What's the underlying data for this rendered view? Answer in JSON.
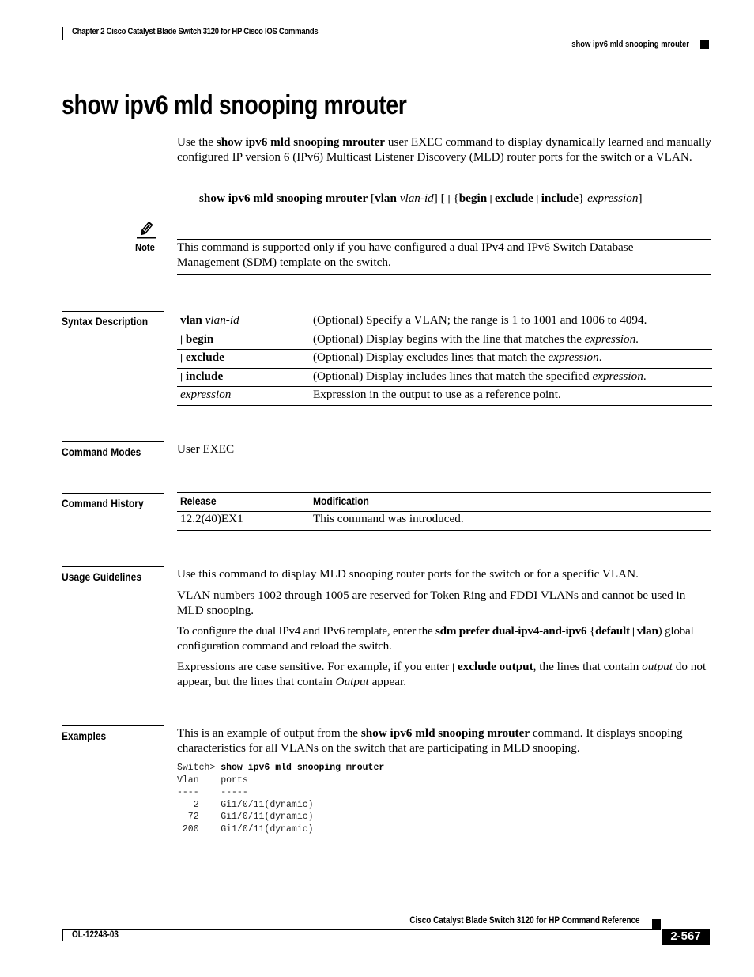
{
  "header": {
    "chapter": "Chapter 2 Cisco Catalyst Blade Switch 3120 for HP Cisco IOS Commands",
    "command": "show ipv6 mld snooping mrouter"
  },
  "title": "show ipv6 mld snooping mrouter",
  "intro": {
    "prefix": "Use the ",
    "command": "show ipv6 mld snooping mrouter",
    "suffix": " user EXEC command to display dynamically learned and manually configured IP version 6 (IPv6) Multicast Listener Discovery (MLD) router ports for the switch or a VLAN."
  },
  "syntax": {
    "command": "show ipv6 mld snooping mrouter",
    "open1": " [",
    "vlan": "vlan",
    "vlan_id": "vlan-id",
    "close1": "] [ ",
    "pipe": "|",
    "brace_open": " {",
    "begin": "begin",
    "sep": " | ",
    "exclude": "exclude",
    "include": "include",
    "brace_close": "} ",
    "expression": "expression",
    "close2": "]"
  },
  "note": {
    "icon": "pencil-note-icon",
    "label": "Note",
    "text": "This command is supported only if you have configured a dual IPv4 and IPv6 Switch Database Management (SDM) template on the switch."
  },
  "syntax_description": {
    "label": "Syntax Description",
    "rows": [
      {
        "kw": "vlan",
        "arg": "vlan-id",
        "desc": "(Optional) Specify a VLAN; the range is 1 to 1001 and 1006 to 4094.",
        "desc_em": ""
      },
      {
        "kw": "begin",
        "pipe": "|",
        "desc": "(Optional) Display begins with the line that matches the ",
        "desc_em": "expression",
        "desc_end": "."
      },
      {
        "kw": "exclude",
        "pipe": "|",
        "desc": "(Optional) Display excludes lines that match the ",
        "desc_em": "expression",
        "desc_end": "."
      },
      {
        "kw": "include",
        "pipe": "|",
        "desc": "(Optional) Display includes lines that match the specified ",
        "desc_em": "expression",
        "desc_end": "."
      },
      {
        "arg": "expression",
        "desc": "Expression in the output to use as a reference point."
      }
    ]
  },
  "command_modes": {
    "label": "Command Modes",
    "value": "User EXEC"
  },
  "command_history": {
    "label": "Command History",
    "headers": [
      "Release",
      "Modification"
    ],
    "rows": [
      [
        "12.2(40)EX1",
        "This command was introduced."
      ]
    ]
  },
  "usage_guidelines": {
    "label": "Usage Guidelines",
    "p1": "Use this command to display MLD snooping router ports for the switch or for a specific VLAN.",
    "p2": "VLAN numbers 1002 through 1005 are reserved for Token Ring and FDDI VLANs and cannot be used in MLD snooping.",
    "p3_prefix": "To configure the dual IPv4 and IPv6 template, enter the ",
    "p3_cmd": "sdm prefer dual-ipv4-and-ipv6",
    "p3_brace_open": " {",
    "p3_default": "default",
    "p3_sep": " | ",
    "p3_vlan": "vlan",
    "p3_brace_close": ")",
    "p3_suffix": " global configuration command and reload the switch.",
    "p4_prefix": "Expressions are case sensitive. For example, if you enter ",
    "p4_pipe": "|",
    "p4_cmd": " exclude output",
    "p4_mid": ", the lines that contain ",
    "p4_em1": "output",
    "p4_mid2": " do not appear, but the lines that contain ",
    "p4_em2": "Output",
    "p4_suffix": " appear."
  },
  "examples": {
    "label": "Examples",
    "intro_prefix": "This is an example of output from the ",
    "intro_cmd": "show ipv6 mld snooping mrouter",
    "intro_suffix": " command. It displays snooping characteristics for all VLANs on the switch that are participating in MLD snooping.",
    "prompt": "Switch> ",
    "command": "show ipv6 mld snooping mrouter",
    "output": "Vlan    ports\n----    -----\n   2    Gi1/0/11(dynamic)\n  72    Gi1/0/11(dynamic)\n 200    Gi1/0/11(dynamic)"
  },
  "footer": {
    "title": "Cisco Catalyst Blade Switch 3120 for HP Command Reference",
    "doc_id": "OL-12248-03",
    "page": "2-567"
  }
}
